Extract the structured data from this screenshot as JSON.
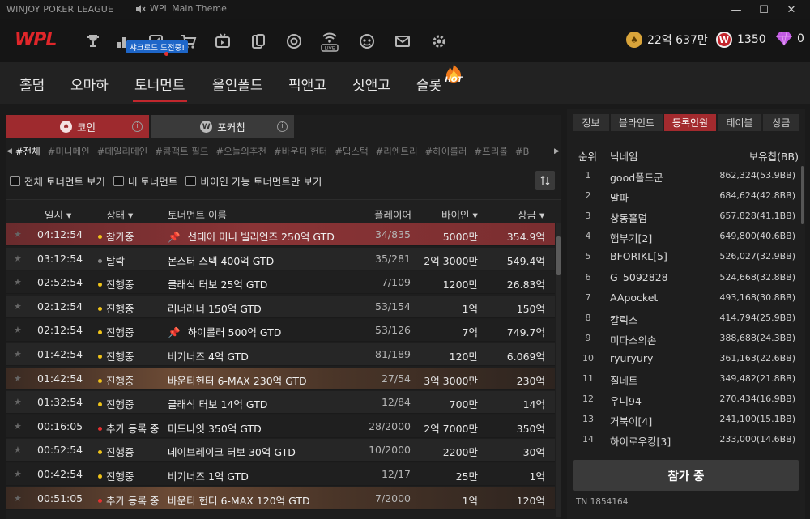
{
  "window": {
    "title": "WINJOY POKER LEAGUE",
    "music_label": "WPL Main Theme",
    "controls": [
      "minimize",
      "maximize",
      "close"
    ]
  },
  "topnav": {
    "logo": "WPL",
    "promo_badge": "샤크로드 도전중!",
    "icons": [
      "trophy-icon",
      "ranking-icon",
      "checkin-icon",
      "cart-icon",
      "tv-icon",
      "cards-icon",
      "chip-icon",
      "live-icon",
      "mascot-icon",
      "mail-icon",
      "settings-icon"
    ],
    "wallet": [
      {
        "name": "gold-coin",
        "value": "22억 637만",
        "color": "#d9a43a"
      },
      {
        "name": "w-chip",
        "value": "1350",
        "color": "#c3242b"
      },
      {
        "name": "diamond",
        "value": "0",
        "color": "#c25ae3"
      }
    ]
  },
  "main_tabs": [
    {
      "label": "홀덤",
      "active": false
    },
    {
      "label": "오마하",
      "active": false
    },
    {
      "label": "토너먼트",
      "active": true
    },
    {
      "label": "올인폴드",
      "active": false
    },
    {
      "label": "픽앤고",
      "active": false
    },
    {
      "label": "싯앤고",
      "active": false
    },
    {
      "label": "슬롯",
      "active": false,
      "badge": "HOT"
    }
  ],
  "currency_tabs": [
    {
      "label": "코인",
      "active": true
    },
    {
      "label": "포커칩",
      "active": false
    }
  ],
  "filters": [
    "#전체",
    "#미니메인",
    "#데일리메인",
    "#콤팩트 필드",
    "#오늘의추천",
    "#바운티 헌터",
    "#딥스택",
    "#리엔트리",
    "#하이롤러",
    "#프리롤",
    "#B"
  ],
  "checkboxes": [
    "전체 토너먼트 보기",
    "내 토너먼트",
    "바이인 가능 토너먼트만 보기"
  ],
  "table": {
    "headers": {
      "time": "일시 ▾",
      "status": "상태 ▾",
      "name": "토너먼트 이름",
      "players": "플레이어",
      "buyin": "바이인 ▾",
      "prize": "상금 ▾"
    },
    "rows": [
      {
        "time": "04:12:54",
        "status": "참가중",
        "status_color": "#f0c419",
        "name": "선데이 미니 빌리언즈 250억 GTD",
        "pin": true,
        "players": "34/835",
        "buyin": "5000만",
        "prize": "354.9억",
        "style": "selected"
      },
      {
        "time": "03:12:54",
        "status": "탈락",
        "status_color": "#888888",
        "name": "몬스터 스택 400억 GTD",
        "pin": false,
        "players": "35/281",
        "buyin": "2억 3000만",
        "prize": "549.4억",
        "style": "alt"
      },
      {
        "time": "02:52:54",
        "status": "진행중",
        "status_color": "#f0c419",
        "name": "클래식 터보 25억 GTD",
        "pin": false,
        "players": "7/109",
        "buyin": "1200만",
        "prize": "26.83억",
        "style": "normal"
      },
      {
        "time": "02:12:54",
        "status": "진행중",
        "status_color": "#f0c419",
        "name": "러너러너 150억 GTD",
        "pin": false,
        "players": "53/154",
        "buyin": "1억",
        "prize": "150억",
        "style": "alt"
      },
      {
        "time": "02:12:54",
        "status": "진행중",
        "status_color": "#f0c419",
        "name": "하이롤러 500억 GTD",
        "pin": true,
        "players": "53/126",
        "buyin": "7억",
        "prize": "749.7억",
        "style": "normal"
      },
      {
        "time": "01:42:54",
        "status": "진행중",
        "status_color": "#f0c419",
        "name": "비기너즈 4억 GTD",
        "pin": false,
        "players": "81/189",
        "buyin": "120만",
        "prize": "6.069억",
        "style": "alt"
      },
      {
        "time": "01:42:54",
        "status": "진행중",
        "status_color": "#f0c419",
        "name": "바운티헌터 6-MAX 230억 GTD",
        "pin": false,
        "players": "27/54",
        "buyin": "3억 3000만",
        "prize": "230억",
        "style": "bounty"
      },
      {
        "time": "01:32:54",
        "status": "진행중",
        "status_color": "#f0c419",
        "name": "클래식 터보 14억 GTD",
        "pin": false,
        "players": "12/84",
        "buyin": "700만",
        "prize": "14억",
        "style": "alt"
      },
      {
        "time": "00:16:05",
        "status": "추가 등록 중",
        "status_color": "#e53030",
        "name": "미드나잇 350억 GTD",
        "pin": false,
        "players": "28/2000",
        "buyin": "2억 7000만",
        "prize": "350억",
        "style": "normal"
      },
      {
        "time": "00:52:54",
        "status": "진행중",
        "status_color": "#f0c419",
        "name": "데이브레이크 터보 30억 GTD",
        "pin": false,
        "players": "10/2000",
        "buyin": "2200만",
        "prize": "30억",
        "style": "alt"
      },
      {
        "time": "00:42:54",
        "status": "진행중",
        "status_color": "#f0c419",
        "name": "비기너즈 1억 GTD",
        "pin": false,
        "players": "12/17",
        "buyin": "25만",
        "prize": "1억",
        "style": "normal"
      },
      {
        "time": "00:51:05",
        "status": "추가 등록 중",
        "status_color": "#e53030",
        "name": "바운티 헌터 6-MAX 120억 GTD",
        "pin": false,
        "players": "7/2000",
        "buyin": "1억",
        "prize": "120억",
        "style": "bounty"
      }
    ]
  },
  "right_panel": {
    "tabs": [
      {
        "label": "정보",
        "active": false
      },
      {
        "label": "블라인드",
        "active": false
      },
      {
        "label": "등록인원",
        "active": true
      },
      {
        "label": "테이블",
        "active": false
      },
      {
        "label": "상금",
        "active": false
      }
    ],
    "headers": {
      "rank": "순위",
      "nick": "닉네임",
      "chips": "보유칩(BB)"
    },
    "players": [
      {
        "rank": "1",
        "nick": "good폴드군",
        "chips": "862,324(53.9BB)"
      },
      {
        "rank": "2",
        "nick": "말파",
        "chips": "684,624(42.8BB)"
      },
      {
        "rank": "3",
        "nick": "창동홀덤",
        "chips": "657,828(41.1BB)"
      },
      {
        "rank": "4",
        "nick": "햄부기[2]",
        "chips": "649,800(40.6BB)"
      },
      {
        "rank": "5",
        "nick": "BFORIKL[5]",
        "chips": "526,027(32.9BB)"
      },
      {
        "rank": "6",
        "nick": "G_5092828",
        "chips": "524,668(32.8BB)"
      },
      {
        "rank": "7",
        "nick": "AApocket",
        "chips": "493,168(30.8BB)"
      },
      {
        "rank": "8",
        "nick": "칼릭스",
        "chips": "414,794(25.9BB)"
      },
      {
        "rank": "9",
        "nick": "미다스의손",
        "chips": "388,688(24.3BB)"
      },
      {
        "rank": "10",
        "nick": "ryuryury",
        "chips": "361,163(22.6BB)"
      },
      {
        "rank": "11",
        "nick": "질네트",
        "chips": "349,482(21.8BB)"
      },
      {
        "rank": "12",
        "nick": "우니94",
        "chips": "270,434(16.9BB)"
      },
      {
        "rank": "13",
        "nick": "거북이[4]",
        "chips": "241,100(15.1BB)"
      },
      {
        "rank": "14",
        "nick": "하이로우킹[3]",
        "chips": "233,000(14.6BB)"
      }
    ],
    "join_button": "참가 중",
    "tn_label": "TN  1854164"
  }
}
